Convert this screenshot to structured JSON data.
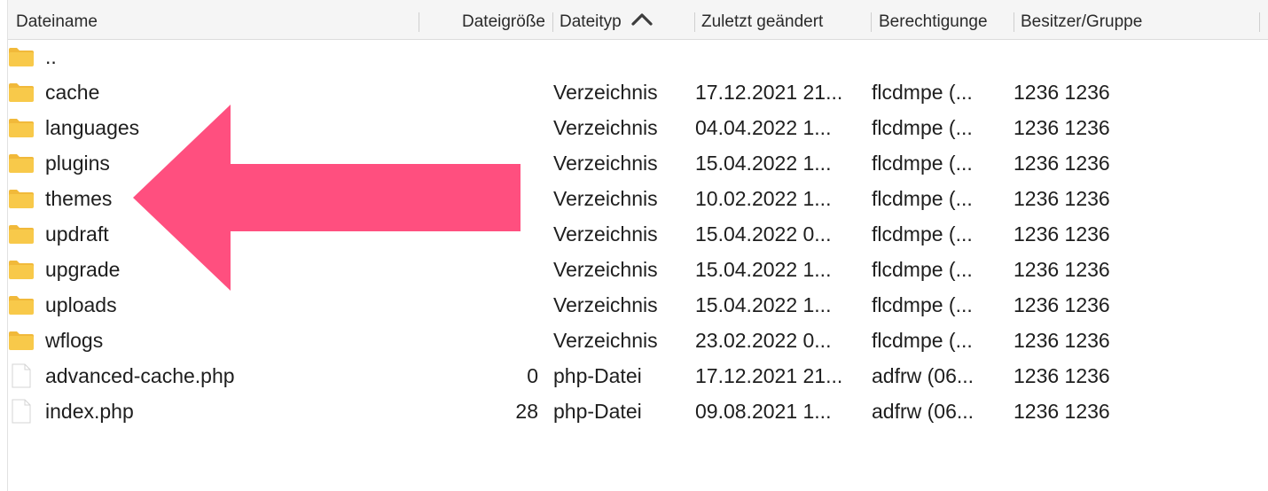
{
  "columns": {
    "name": "Dateiname",
    "size": "Dateigröße",
    "type": "Dateityp",
    "modified": "Zuletzt geändert",
    "permissions": "Berechtigunge",
    "owner": "Besitzer/Gruppe"
  },
  "sort": {
    "column": "Dateityp",
    "direction": "ascending",
    "icon": "chevron-up-icon"
  },
  "annotation": {
    "color": "#ff4f7f",
    "icon": "left-arrow"
  },
  "colors": {
    "folder": "#f8c94a",
    "folder_tab": "#f1b93a",
    "file": "#ffffff"
  },
  "rows": [
    {
      "name": "..",
      "size": "",
      "type": "",
      "modified": "",
      "permissions": "",
      "owner": "",
      "icon": "folder-icon"
    },
    {
      "name": "cache",
      "size": "",
      "type": "Verzeichnis",
      "modified": "17.12.2021 21...",
      "permissions": "flcdmpe (...",
      "owner": "1236 1236",
      "icon": "folder-icon"
    },
    {
      "name": "languages",
      "size": "",
      "type": "Verzeichnis",
      "modified": "04.04.2022 1...",
      "permissions": "flcdmpe (...",
      "owner": "1236 1236",
      "icon": "folder-icon"
    },
    {
      "name": "plugins",
      "size": "",
      "type": "Verzeichnis",
      "modified": "15.04.2022 1...",
      "permissions": "flcdmpe (...",
      "owner": "1236 1236",
      "icon": "folder-icon"
    },
    {
      "name": "themes",
      "size": "",
      "type": "Verzeichnis",
      "modified": "10.02.2022 1...",
      "permissions": "flcdmpe (...",
      "owner": "1236 1236",
      "icon": "folder-icon"
    },
    {
      "name": "updraft",
      "size": "",
      "type": "Verzeichnis",
      "modified": "15.04.2022 0...",
      "permissions": "flcdmpe (...",
      "owner": "1236 1236",
      "icon": "folder-icon"
    },
    {
      "name": "upgrade",
      "size": "",
      "type": "Verzeichnis",
      "modified": "15.04.2022 1...",
      "permissions": "flcdmpe (...",
      "owner": "1236 1236",
      "icon": "folder-icon"
    },
    {
      "name": "uploads",
      "size": "",
      "type": "Verzeichnis",
      "modified": "15.04.2022 1...",
      "permissions": "flcdmpe (...",
      "owner": "1236 1236",
      "icon": "folder-icon"
    },
    {
      "name": "wflogs",
      "size": "",
      "type": "Verzeichnis",
      "modified": "23.02.2022 0...",
      "permissions": "flcdmpe (...",
      "owner": "1236 1236",
      "icon": "folder-icon"
    },
    {
      "name": "advanced-cache.php",
      "size": "0",
      "type": "php-Datei",
      "modified": "17.12.2021 21...",
      "permissions": "adfrw (06...",
      "owner": "1236 1236",
      "icon": "file-icon"
    },
    {
      "name": "index.php",
      "size": "28",
      "type": "php-Datei",
      "modified": "09.08.2021 1...",
      "permissions": "adfrw (06...",
      "owner": "1236 1236",
      "icon": "file-icon"
    }
  ]
}
